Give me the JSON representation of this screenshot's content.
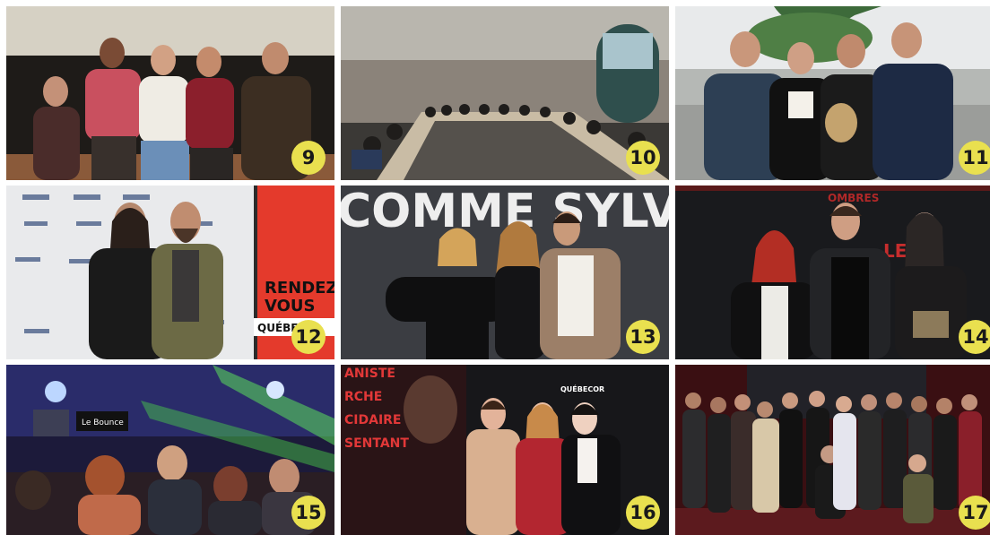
{
  "photos": [
    {
      "number": "9"
    },
    {
      "number": "10"
    },
    {
      "number": "11"
    },
    {
      "number": "12",
      "backdrop_text": [
        "RENDEZ",
        "VOUS",
        "QUÉBEC"
      ]
    },
    {
      "number": "13",
      "backdrop_text": "COMME SYLVA"
    },
    {
      "number": "14",
      "backdrop_text": [
        "LES",
        "OMBRES"
      ]
    },
    {
      "number": "15",
      "screen_text": "Le Bounce"
    },
    {
      "number": "16",
      "backdrop_text": [
        "ANISTE",
        "RCHE",
        "CIDAIRE",
        "SENTANT"
      ],
      "logo_text": "QUÉBECOR"
    },
    {
      "number": "17"
    }
  ],
  "colors": {
    "badge": "#e9e04f",
    "badge_text": "#1a1a1a"
  }
}
